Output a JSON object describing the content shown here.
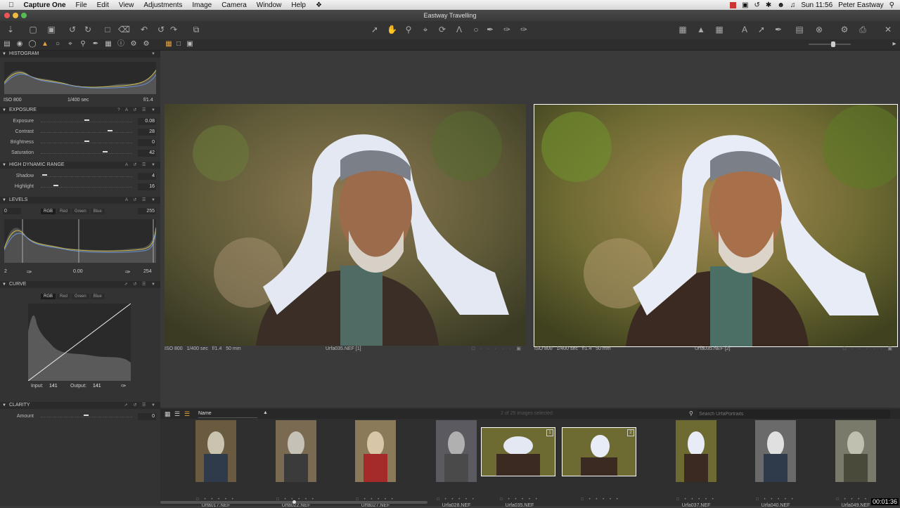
{
  "menubar": {
    "app": "Capture One",
    "items": [
      "File",
      "Edit",
      "View",
      "Adjustments",
      "Image",
      "Camera",
      "Window",
      "Help"
    ],
    "clock": "Sun 11:56",
    "user": "Peter Eastway"
  },
  "window": {
    "title": "Eastway Travelling"
  },
  "histogram": {
    "title": "HISTOGRAM",
    "iso": "ISO 800",
    "shutter": "1/400 sec",
    "aperture": "f/1.4"
  },
  "exposure": {
    "title": "EXPOSURE",
    "rows": [
      {
        "label": "Exposure",
        "value": "0.08",
        "pos": 0.5
      },
      {
        "label": "Contrast",
        "value": "28",
        "pos": 0.75
      },
      {
        "label": "Brightness",
        "value": "0",
        "pos": 0.5
      },
      {
        "label": "Saturation",
        "value": "42",
        "pos": 0.7
      }
    ]
  },
  "hdr": {
    "title": "HIGH DYNAMIC RANGE",
    "rows": [
      {
        "label": "Shadow",
        "value": "4",
        "pos": 0.04
      },
      {
        "label": "Highlight",
        "value": "16",
        "pos": 0.16
      }
    ]
  },
  "levels": {
    "title": "LEVELS",
    "left": "0",
    "right": "255",
    "tabs": [
      "RGB",
      "Red",
      "Green",
      "Blue"
    ],
    "low": "2",
    "mid": "0.00",
    "high": "254"
  },
  "curve": {
    "title": "CURVE",
    "tabs": [
      "RGB",
      "Red",
      "Green",
      "Blue"
    ],
    "input_label": "Input:",
    "input": "141",
    "output_label": "Output:",
    "output": "141"
  },
  "clarity": {
    "title": "CLARITY",
    "amount_label": "Amount",
    "amount": "0"
  },
  "viewer": {
    "left": {
      "iso": "ISO 800",
      "shutter": "1/400 sec",
      "aperture": "f/1.4",
      "focal": "50 mm",
      "file": "Urfa035.NEF [1]"
    },
    "right": {
      "iso": "ISO 800",
      "shutter": "1/400 sec",
      "aperture": "f/1.4",
      "focal": "50 mm",
      "file": "Urfa035.NEF [2]"
    }
  },
  "browser": {
    "sort_label": "Name",
    "selection": "2 of 25 images selected",
    "search_placeholder": "Search UrfaPortraits",
    "thumbs": [
      "Urfa017.NEF",
      "Urfa022.NEF",
      "Urfa027.NEF",
      "Urfa028.NEF",
      "Urfa035.NEF",
      "Urfa037.NEF",
      "Urfa040.NEF",
      "Urfa049.NEF"
    ],
    "variant_badges": [
      "1",
      "2"
    ]
  },
  "timestamp": "00:01:36",
  "colors": {
    "panel": "#333333",
    "viewer": "#3a3a3a",
    "accent": "#e8a23c",
    "selection_border": "#ffffff"
  }
}
